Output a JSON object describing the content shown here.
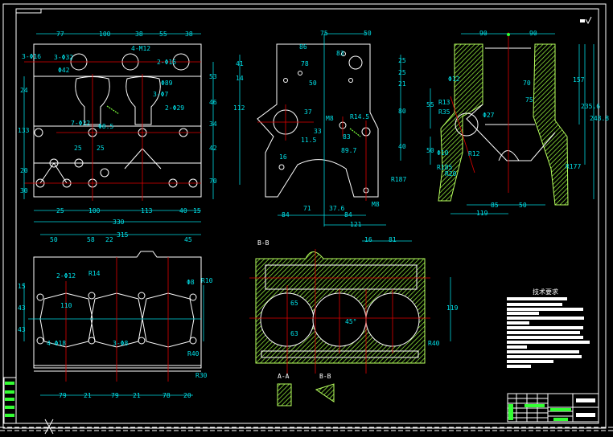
{
  "colors": {
    "background": "#000000",
    "outline": "#ffffff",
    "dimension": "#00e0e8",
    "centerline": "#e00000",
    "hatch": "#7cff3a"
  },
  "view_front": {
    "dims": [
      "77",
      "100",
      "38",
      "55",
      "38",
      "25",
      "100",
      "113",
      "40",
      "15",
      "330",
      "3-Φ16",
      "3-Φ32",
      "Φ42",
      "24",
      "133",
      "20",
      "30",
      "53",
      "46",
      "34",
      "42",
      "70",
      "4-M12",
      "2-Φ16",
      "Φ89",
      "3-Φ7",
      "2-Φ29",
      "7-Φ22",
      "Φ8.5",
      "25",
      "25"
    ]
  },
  "view_side": {
    "dims": [
      "75",
      "50",
      "86",
      "83",
      "78",
      "50",
      "41",
      "14",
      "112",
      "25",
      "25",
      "21",
      "80",
      "37",
      "33",
      "11.5",
      "M8",
      "R14.5",
      "83",
      "89.7",
      "16",
      "R187",
      "M8",
      "71",
      "37.6",
      "84",
      "84",
      "121",
      "40"
    ]
  },
  "view_section": {
    "dims": [
      "90",
      "90",
      "Φ12",
      "R13",
      "R35",
      "70",
      "75",
      "Φ27",
      "157",
      "235.6",
      "248.8",
      "Φ10",
      "R12",
      "R185",
      "R20",
      "85",
      "50",
      "119",
      "55",
      "50",
      "R177"
    ]
  },
  "view_top": {
    "dims": [
      "315",
      "50",
      "58",
      "22",
      "45",
      "R14",
      "2-Φ12",
      "15",
      "43",
      "43",
      "110",
      "4-Φ18",
      "3-Φ8",
      "Φ8",
      "R10",
      "R40",
      "R30",
      "79",
      "21",
      "79",
      "21",
      "78",
      "20"
    ]
  },
  "view_bb": {
    "dims": [
      "16",
      "81",
      "65",
      "63",
      "45°",
      "119",
      "R40",
      "A-A",
      "B-B"
    ]
  },
  "notes": {
    "title": "技术要求",
    "items": [
      "1",
      "2",
      "3",
      "4",
      "5",
      "6",
      "7",
      "8",
      "9",
      "10",
      "11"
    ]
  }
}
